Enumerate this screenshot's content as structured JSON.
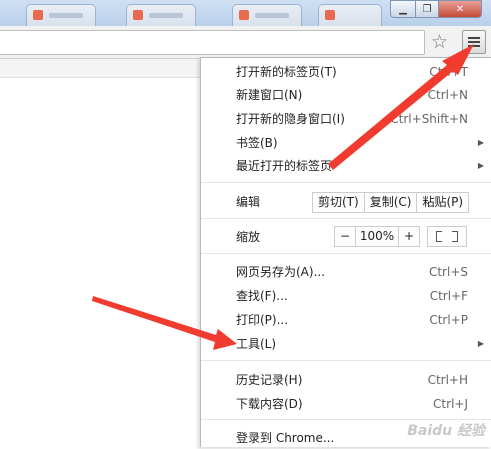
{
  "browser": {
    "bookmark_star_icon": "star-outline-icon",
    "menu_icon": "hamburger-icon"
  },
  "menu": {
    "new_tab": {
      "label": "打开新的标签页(T)",
      "shortcut": "Ctrl+T"
    },
    "new_window": {
      "label": "新建窗口(N)",
      "shortcut": "Ctrl+N"
    },
    "incognito": {
      "label": "打开新的隐身窗口(I)",
      "shortcut": "Ctrl+Shift+N"
    },
    "bookmarks": {
      "label": "书签(B)"
    },
    "recent_tabs": {
      "label": "最近打开的标签页"
    },
    "edit": {
      "label": "编辑",
      "cut": "剪切(T)",
      "copy": "复制(C)",
      "paste": "粘贴(P)"
    },
    "zoom": {
      "label": "缩放",
      "minus": "−",
      "value": "100%",
      "plus": "+"
    },
    "save_as": {
      "label": "网页另存为(A)...",
      "shortcut": "Ctrl+S"
    },
    "find": {
      "label": "查找(F)...",
      "shortcut": "Ctrl+F"
    },
    "print": {
      "label": "打印(P)...",
      "shortcut": "Ctrl+P"
    },
    "tools": {
      "label": "工具(L)"
    },
    "history": {
      "label": "历史记录(H)",
      "shortcut": "Ctrl+H"
    },
    "downloads": {
      "label": "下载内容(D)",
      "shortcut": "Ctrl+J"
    },
    "signin": {
      "label": "登录到 Chrome..."
    }
  },
  "annotation": {
    "arrow_color": "#f23b2f"
  },
  "watermark": "Baidu 经验"
}
